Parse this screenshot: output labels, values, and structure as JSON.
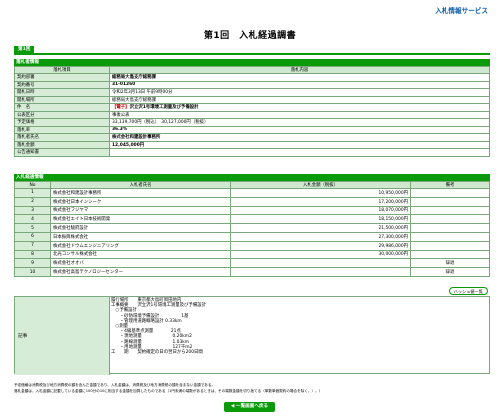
{
  "header": {
    "service_label": "入札情報サービス",
    "title": "第1回　入札経過調書",
    "round_tab": "第1回"
  },
  "award": {
    "section_label": "落札者情報",
    "col_item": "落札項目",
    "col_content": "落札内容",
    "rows": [
      {
        "label": "契約部署",
        "value": "総務局大島支庁総務課",
        "bold": true
      },
      {
        "label": "契約番号",
        "value": "31-01260",
        "bold": true
      },
      {
        "label": "開札日時",
        "value": "令和2年3月13日 午前9時00分",
        "bold": false
      },
      {
        "label": "開札場所",
        "value": "総務局大島支庁総務課",
        "bold": false
      },
      {
        "label": "件　名",
        "flag": "【電子】",
        "value": "沢立沢1号環境工測量及び予備設計",
        "bold": true
      },
      {
        "label": "公表区分",
        "value": "事後公表",
        "bold": false
      },
      {
        "label": "予定価格",
        "value": "33,139,700円（税込）　30,127,000円（税抜）",
        "bold": false
      },
      {
        "label": "落札率",
        "value": "36.3%",
        "bold": true
      },
      {
        "label": "落札者氏名",
        "value": "株式会社和建設計事務所",
        "bold": true
      },
      {
        "label": "落札金額",
        "value": "12,045,000円",
        "bold": true
      },
      {
        "label": "公告通知書",
        "value": "",
        "bold": false
      }
    ]
  },
  "bids": {
    "section_label": "入札経過情報",
    "col_no": "No",
    "col_name": "入札者氏名",
    "col_amount": "入札金額（税抜）",
    "col_remark": "備考",
    "rows": [
      {
        "no": "1",
        "name": "株式会社和建設計事務所",
        "amount": "10,950,000円",
        "remark": ""
      },
      {
        "no": "2",
        "name": "株式会社日本インシーク",
        "amount": "17,200,000円",
        "remark": ""
      },
      {
        "no": "3",
        "name": "株式会社フジヤマ",
        "amount": "18,070,000円",
        "remark": ""
      },
      {
        "no": "4",
        "name": "株式会社エイト日本技術開発",
        "amount": "18,150,000円",
        "remark": ""
      },
      {
        "no": "5",
        "name": "株式会社駿府設計",
        "amount": "21,500,000円",
        "remark": ""
      },
      {
        "no": "6",
        "name": "日本振興株式会社",
        "amount": "27,300,000円",
        "remark": ""
      },
      {
        "no": "7",
        "name": "株式会社ドウムエンジニアリング",
        "amount": "29,986,000円",
        "remark": ""
      },
      {
        "no": "8",
        "name": "北光コンサル株式会社",
        "amount": "30,000,000円",
        "remark": ""
      },
      {
        "no": "9",
        "name": "株式会社オオバ",
        "amount": "",
        "remark": "辞退"
      },
      {
        "no": "10",
        "name": "株式会社高島テクノロジーセンター",
        "amount": "",
        "remark": "辞退"
      }
    ],
    "row_list_link": "ハッシュ値一覧"
  },
  "notes": {
    "label": "記事",
    "lines": [
      "履行場所　　東京都大島町岡田地内",
      "工事概要　　沢立沢1号環境工測量及び予備設計",
      "　○予備設計",
      "　　・砂防環境予備設計　　　　　1基",
      "　　・管理用道路概略設計 0.33km",
      "　○測量",
      "　　・4級基準点測量　　　　21点",
      "　　・現地測量　　　　　　　0.20km2",
      "　　・路線測量　　　　　　　1.03km",
      "　　・用地測量　　　　　　　127千m2",
      "工　　期　　契約確定の日の翌日から200日間"
    ]
  },
  "footnotes": [
    "予定価格は消費税及び地方消費税の額を含んだ金額であり、入札金額は、消費税及び地方消費税の額を含まない金額である。",
    "落札金額は、入札金額に記載している金額に100分の10に相当する金額を加算したものである（1円未満の端数があるときは、その端数金額を切り捨てる（単数単価契約の場合を除く。）。）"
  ],
  "back_button": "◀ 一覧画面へ戻る"
}
